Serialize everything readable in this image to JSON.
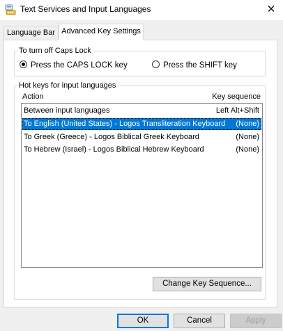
{
  "window": {
    "title": "Text Services and Input Languages",
    "close_symbol": "✕"
  },
  "tabs": [
    {
      "label": "Language Bar",
      "active": false
    },
    {
      "label": "Advanced Key Settings",
      "active": true
    }
  ],
  "caps_lock": {
    "legend": "To turn off Caps Lock",
    "options": [
      {
        "label": "Press the CAPS LOCK key",
        "selected": true
      },
      {
        "label": "Press the SHIFT key",
        "selected": false
      }
    ]
  },
  "hotkeys": {
    "legend": "Hot keys for input languages",
    "columns": {
      "action": "Action",
      "sequence": "Key sequence"
    },
    "rows": [
      {
        "action": "Between input languages",
        "sequence": "Left Alt+Shift",
        "selected": false
      },
      {
        "action": "To English (United States) - Logos Transliteration Keyboard",
        "sequence": "(None)",
        "selected": true
      },
      {
        "action": "To Greek (Greece) - Logos Biblical Greek Keyboard",
        "sequence": "(None)",
        "selected": false
      },
      {
        "action": "To Hebrew (Israel) - Logos Biblical Hebrew Keyboard",
        "sequence": "(None)",
        "selected": false
      }
    ],
    "change_button": "Change Key Sequence..."
  },
  "footer": {
    "ok": "OK",
    "cancel": "Cancel",
    "apply": "Apply"
  },
  "colors": {
    "selection": "#0078d7",
    "default_button_border": "#0078d7"
  },
  "icons": {
    "title": "keyboard-language-icon",
    "close": "close-icon"
  }
}
